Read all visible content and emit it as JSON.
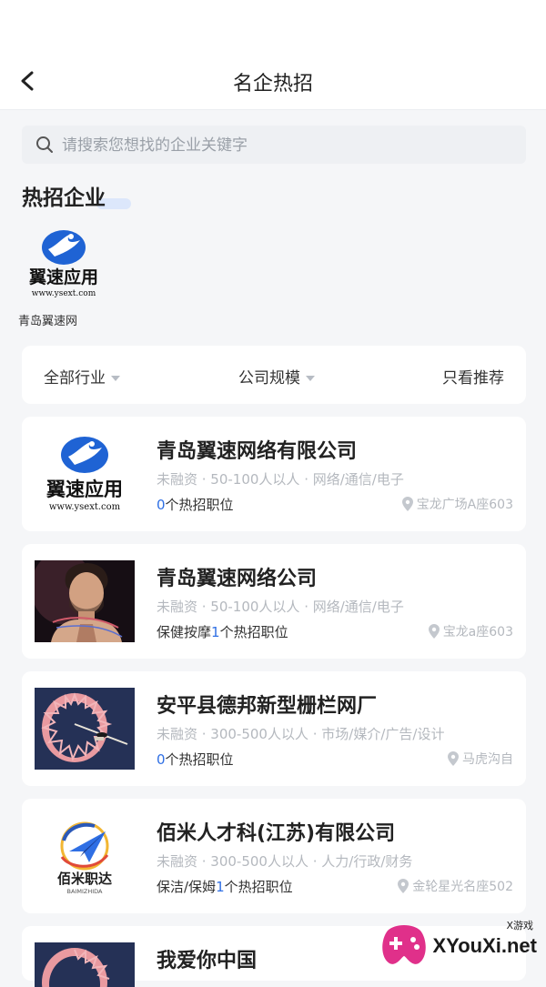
{
  "header": {
    "title": "名企热招",
    "back_icon": "chevron-left-icon"
  },
  "search": {
    "placeholder": "请搜索您想找的企业关键字",
    "value": ""
  },
  "hot_section": {
    "title": "热招企业",
    "items": [
      {
        "name": "青岛翼速网",
        "logo_title": "翼速应用",
        "logo_url": "www.ysext.com"
      }
    ]
  },
  "filters": {
    "industry": "全部行业",
    "scale": "公司规模",
    "recommend": "只看推荐"
  },
  "companies": [
    {
      "name": "青岛翼速网络有限公司",
      "meta": "未融资 · 50-100人以人 · 网络/通信/电子",
      "job_prefix": "",
      "count": "0",
      "job_suffix": "个热招职位",
      "location": "宝龙广场A座603",
      "logo_title": "翼速应用",
      "logo_url": "www.ysext.com"
    },
    {
      "name": "青岛翼速网络公司",
      "meta": "未融资 · 50-100人以人 · 网络/通信/电子",
      "job_prefix": "保健按摩",
      "count": "1",
      "job_suffix": "个热招职位",
      "location": "宝龙a座603"
    },
    {
      "name": "安平县德邦新型栅栏网厂",
      "meta": "未融资 · 300-500人以人 · 市场/媒介/广告/设计",
      "job_prefix": "",
      "count": "0",
      "job_suffix": "个热招职位",
      "location": "马虎沟自"
    },
    {
      "name": "佰米人才科(江苏)有限公司",
      "meta": "未融资 · 300-500人以人 · 人力/行政/财务",
      "job_prefix": "保洁/保姆",
      "count": "1",
      "job_suffix": "个热招职位",
      "location": "金轮星光名座502",
      "logo_title": "佰米职达",
      "logo_sub": "BAIMIZHIDA"
    },
    {
      "name": "我爱你中国"
    }
  ],
  "watermark": {
    "text": "XYouXi.net",
    "small": "X游戏"
  },
  "colors": {
    "accent": "#2f6fe4",
    "background": "#f5f6f8",
    "card": "#ffffff"
  }
}
